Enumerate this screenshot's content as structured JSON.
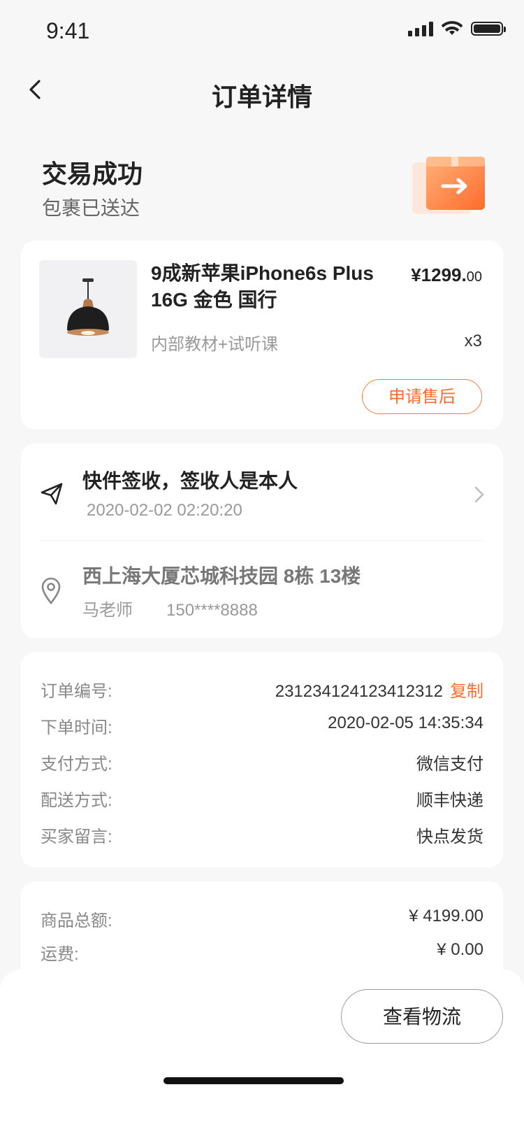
{
  "status_bar": {
    "time": "9:41"
  },
  "nav": {
    "title": "订单详情"
  },
  "order_status": {
    "title": "交易成功",
    "subtitle": "包裹已送达"
  },
  "product": {
    "name": "9成新苹果iPhone6s Plus 16G 金色 国行",
    "price_main": "¥1299.",
    "price_decimal": "00",
    "spec": "内部教材+试听课",
    "quantity": "x3",
    "after_sale_label": "申请售后"
  },
  "delivery": {
    "title": "快件签收，签收人是本人",
    "time": "2020-02-02 02:20:20",
    "address": "西上海大厦芯城科技园 8栋 13楼",
    "contact_name": "马老师",
    "contact_phone": "150****8888"
  },
  "order_info": {
    "rows": [
      {
        "label": "订单编号:",
        "value": "231234124123412312"
      },
      {
        "label": "下单时间:",
        "value": "2020-02-05 14:35:34"
      },
      {
        "label": "支付方式:",
        "value": "微信支付"
      },
      {
        "label": "配送方式:",
        "value": "顺丰快递"
      },
      {
        "label": "买家留言:",
        "value": "快点发货"
      }
    ],
    "copy_label": "复制"
  },
  "amounts": {
    "rows": [
      {
        "label": "商品总额:",
        "value": "¥ 4199.00"
      },
      {
        "label": "运费:",
        "value": "¥ 0.00"
      }
    ]
  },
  "bottom": {
    "logistics_label": "查看物流"
  },
  "colors": {
    "accent": "#ff6b2c",
    "background": "#f7f7f7"
  },
  "icons": [
    "back-arrow-icon",
    "signal-icon",
    "wifi-icon",
    "battery-icon",
    "package-box-icon",
    "send-icon",
    "chevron-right-icon",
    "location-pin-icon"
  ]
}
